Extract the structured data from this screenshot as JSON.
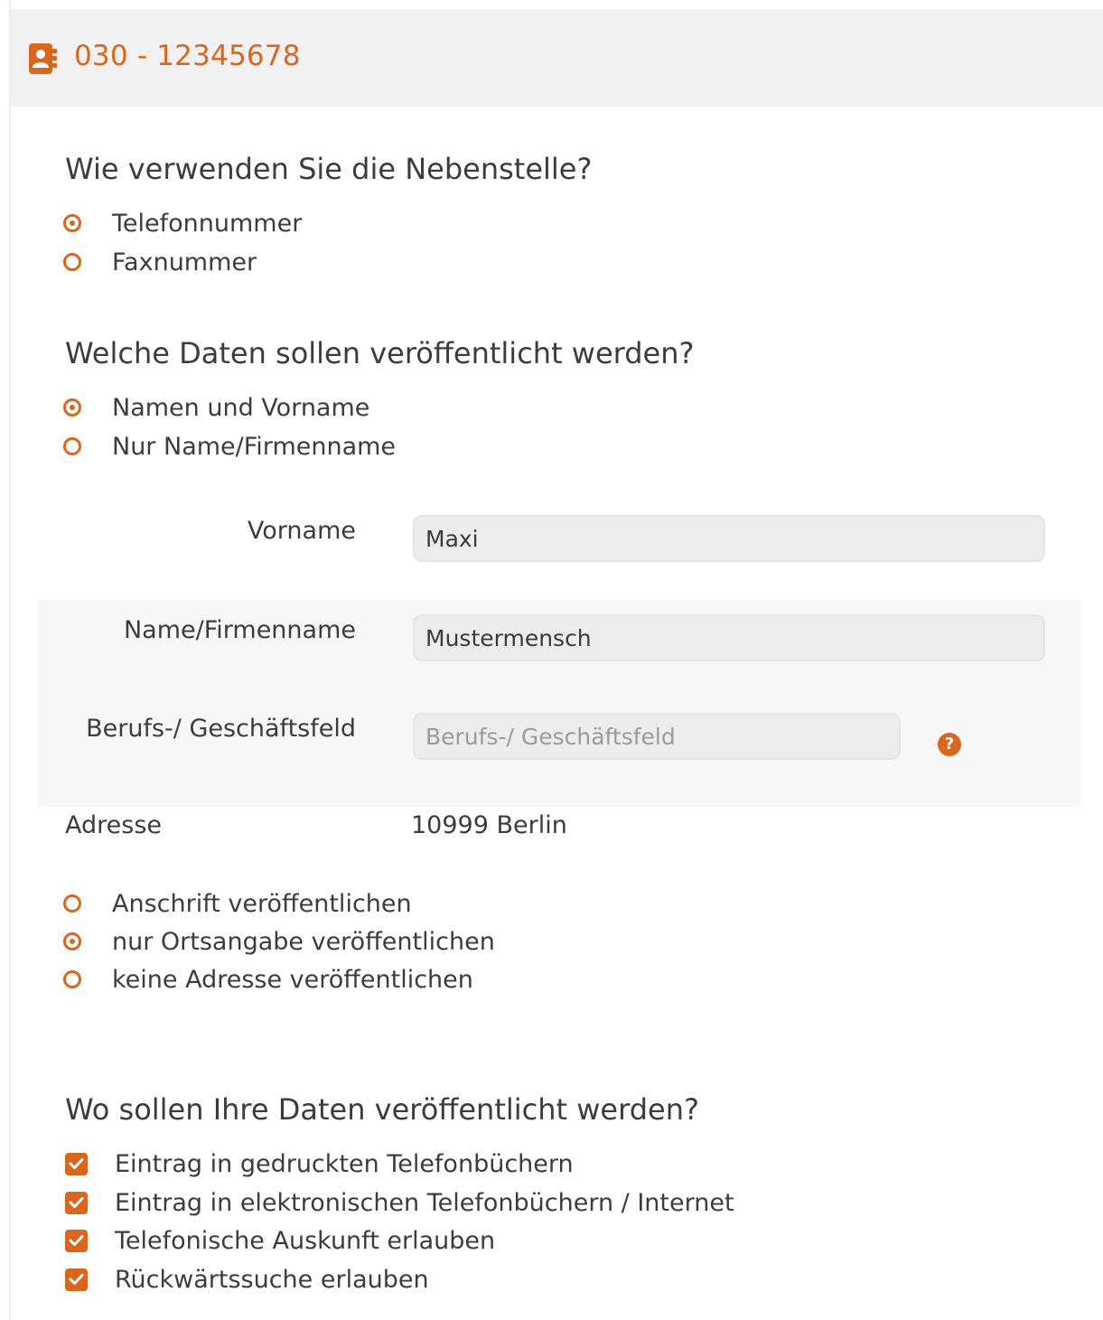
{
  "colors": {
    "accent": "#d9661f",
    "header_bg": "#f1f1f1",
    "input_bg": "#ececec",
    "text": "#3c3c3c"
  },
  "header": {
    "icon": "phonebook-icon",
    "title": "030 - 12345678"
  },
  "usage": {
    "question": "Wie verwenden Sie die Nebenstelle?",
    "options": [
      {
        "label": "Telefonnummer",
        "checked": true
      },
      {
        "label": "Faxnummer",
        "checked": false
      }
    ]
  },
  "publish_data": {
    "question": "Welche Daten sollen veröffentlicht werden?",
    "options": [
      {
        "label": "Namen und Vorname",
        "checked": true
      },
      {
        "label": "Nur Name/Firmenname",
        "checked": false
      }
    ]
  },
  "fields": {
    "vorname": {
      "label": "Vorname",
      "value": "Maxi"
    },
    "name": {
      "label": "Name/Firmenname",
      "value": "Mustermensch"
    },
    "beruf": {
      "label": "Berufs-/ Geschäftsfeld",
      "value": "",
      "placeholder": "Berufs-/ Geschäftsfeld",
      "help_icon": "question-icon",
      "help_glyph": "?"
    }
  },
  "address": {
    "label": "Adresse",
    "value": "10999 Berlin",
    "options": [
      {
        "label": "Anschrift veröffentlichen",
        "checked": false
      },
      {
        "label": "nur Ortsangabe veröffentlichen",
        "checked": true
      },
      {
        "label": "keine Adresse veröffentlichen",
        "checked": false
      }
    ]
  },
  "channels": {
    "question": "Wo sollen Ihre Daten veröffentlicht werden?",
    "options": [
      {
        "label": "Eintrag in gedruckten Telefonbüchern",
        "checked": true
      },
      {
        "label": "Eintrag in elektronischen Telefonbüchern / Internet",
        "checked": true
      },
      {
        "label": "Telefonische Auskunft erlauben",
        "checked": true
      },
      {
        "label": "Rückwärtssuche erlauben",
        "checked": true
      }
    ]
  }
}
